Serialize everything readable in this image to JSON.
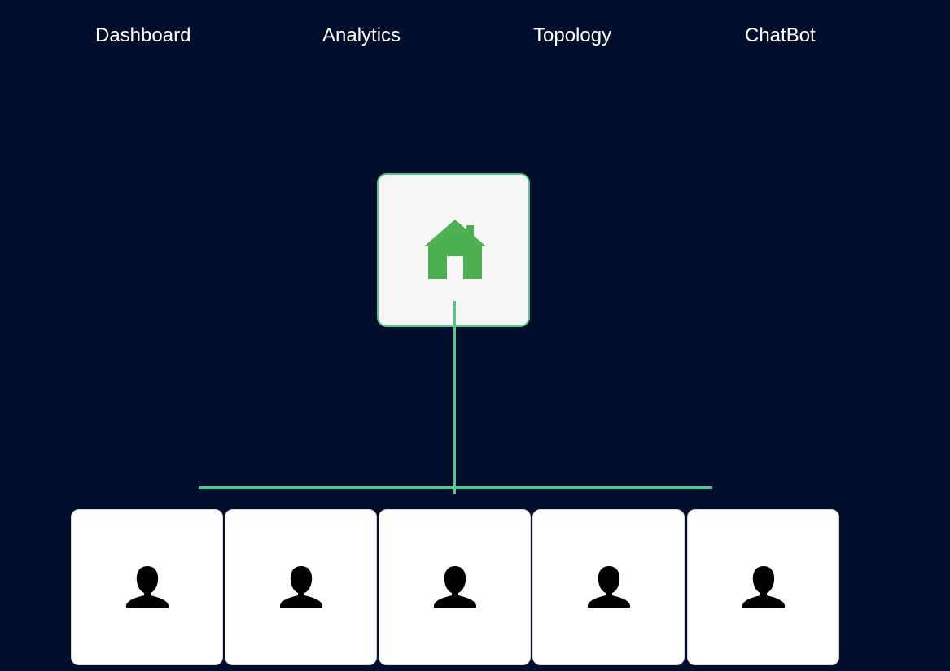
{
  "nav": {
    "items": [
      {
        "label": "Dashboard"
      },
      {
        "label": "Analytics"
      },
      {
        "label": "Topology"
      },
      {
        "label": "ChatBot"
      }
    ]
  },
  "topology": {
    "hub": {
      "icon": "home-icon",
      "icon_color": "#4caf50"
    },
    "devices": [
      {
        "icon": "user-icon"
      },
      {
        "icon": "user-icon"
      },
      {
        "icon": "user-icon"
      },
      {
        "icon": "user-icon"
      },
      {
        "icon": "user-icon"
      }
    ],
    "link_color": "#52c88a"
  },
  "colors": {
    "background": "#020e2b",
    "nav_text": "#ffffff"
  }
}
